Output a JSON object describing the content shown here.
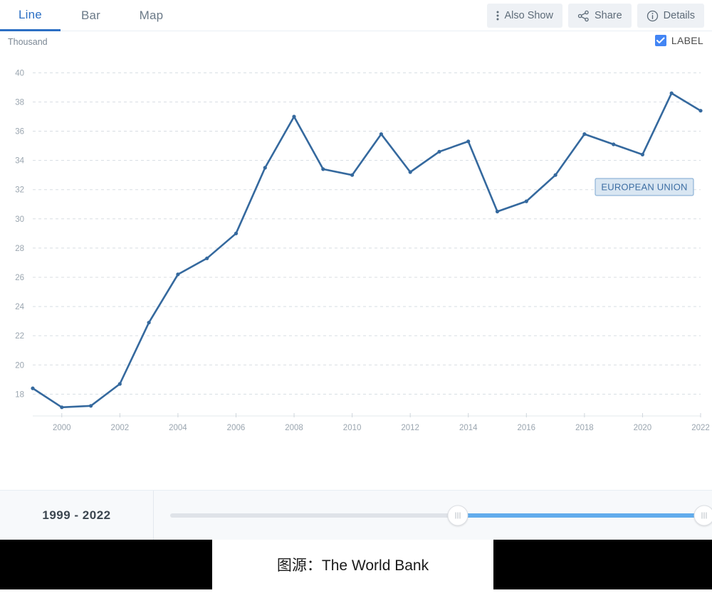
{
  "tabs": [
    {
      "label": "Line",
      "active": true,
      "name": "tab-line"
    },
    {
      "label": "Bar",
      "active": false,
      "name": "tab-bar"
    },
    {
      "label": "Map",
      "active": false,
      "name": "tab-map"
    }
  ],
  "toolbar": {
    "also_show_label": "Also Show",
    "share_label": "Share",
    "details_label": "Details",
    "also_show_icon": "vertical-dots-icon",
    "share_icon": "share-icon",
    "details_icon": "info-circle-icon"
  },
  "chart_header": {
    "unit": "Thousand",
    "label_toggle_text": "LABEL",
    "label_toggle_checked": true
  },
  "time_slider": {
    "range_text": "1999 - 2022",
    "start_year": 1999,
    "end_year": 2022,
    "handle_left_icon": "grip-handle-icon",
    "handle_right_icon": "grip-handle-icon"
  },
  "footer": {
    "caption": "图源：The World Bank"
  },
  "colors": {
    "accent": "#2c6fc4",
    "series": "#35699e",
    "label_box_fill": "#d9e6f2",
    "label_box_border": "#7ba7d0",
    "slider_active": "#62acec",
    "checkbox": "#4285f4"
  },
  "chart_data": {
    "type": "line",
    "title": "",
    "subtitle": "",
    "xlabel": "",
    "ylabel": "Thousand",
    "unit": "Thousand",
    "grid": true,
    "legend_position": "inline-label",
    "series_label": "EUROPEAN UNION",
    "x": [
      1999,
      2000,
      2001,
      2002,
      2003,
      2004,
      2005,
      2006,
      2007,
      2008,
      2009,
      2010,
      2011,
      2012,
      2013,
      2014,
      2015,
      2016,
      2017,
      2018,
      2019,
      2020,
      2021,
      2022
    ],
    "xtick_labels": [
      "2000",
      "2002",
      "2004",
      "2006",
      "2008",
      "2010",
      "2012",
      "2014",
      "2016",
      "2018",
      "2020",
      "2022"
    ],
    "xtick_values": [
      2000,
      2002,
      2004,
      2006,
      2008,
      2010,
      2012,
      2014,
      2016,
      2018,
      2020,
      2022
    ],
    "ytick_labels": [
      "18",
      "20",
      "22",
      "24",
      "26",
      "28",
      "30",
      "32",
      "34",
      "36",
      "38",
      "40"
    ],
    "ytick_values": [
      18,
      20,
      22,
      24,
      26,
      28,
      30,
      32,
      34,
      36,
      38,
      40
    ],
    "xlim": [
      1999,
      2022
    ],
    "ylim": [
      16.8,
      40.6
    ],
    "series": [
      {
        "name": "EUROPEAN UNION",
        "color": "#35699e",
        "values": [
          18.4,
          17.1,
          17.2,
          18.7,
          22.9,
          26.2,
          27.3,
          29.0,
          33.5,
          37.0,
          33.4,
          33.0,
          35.8,
          33.2,
          34.6,
          35.3,
          30.5,
          31.2,
          33.0,
          35.8,
          35.1,
          34.4,
          38.6,
          37.4
        ]
      }
    ]
  }
}
